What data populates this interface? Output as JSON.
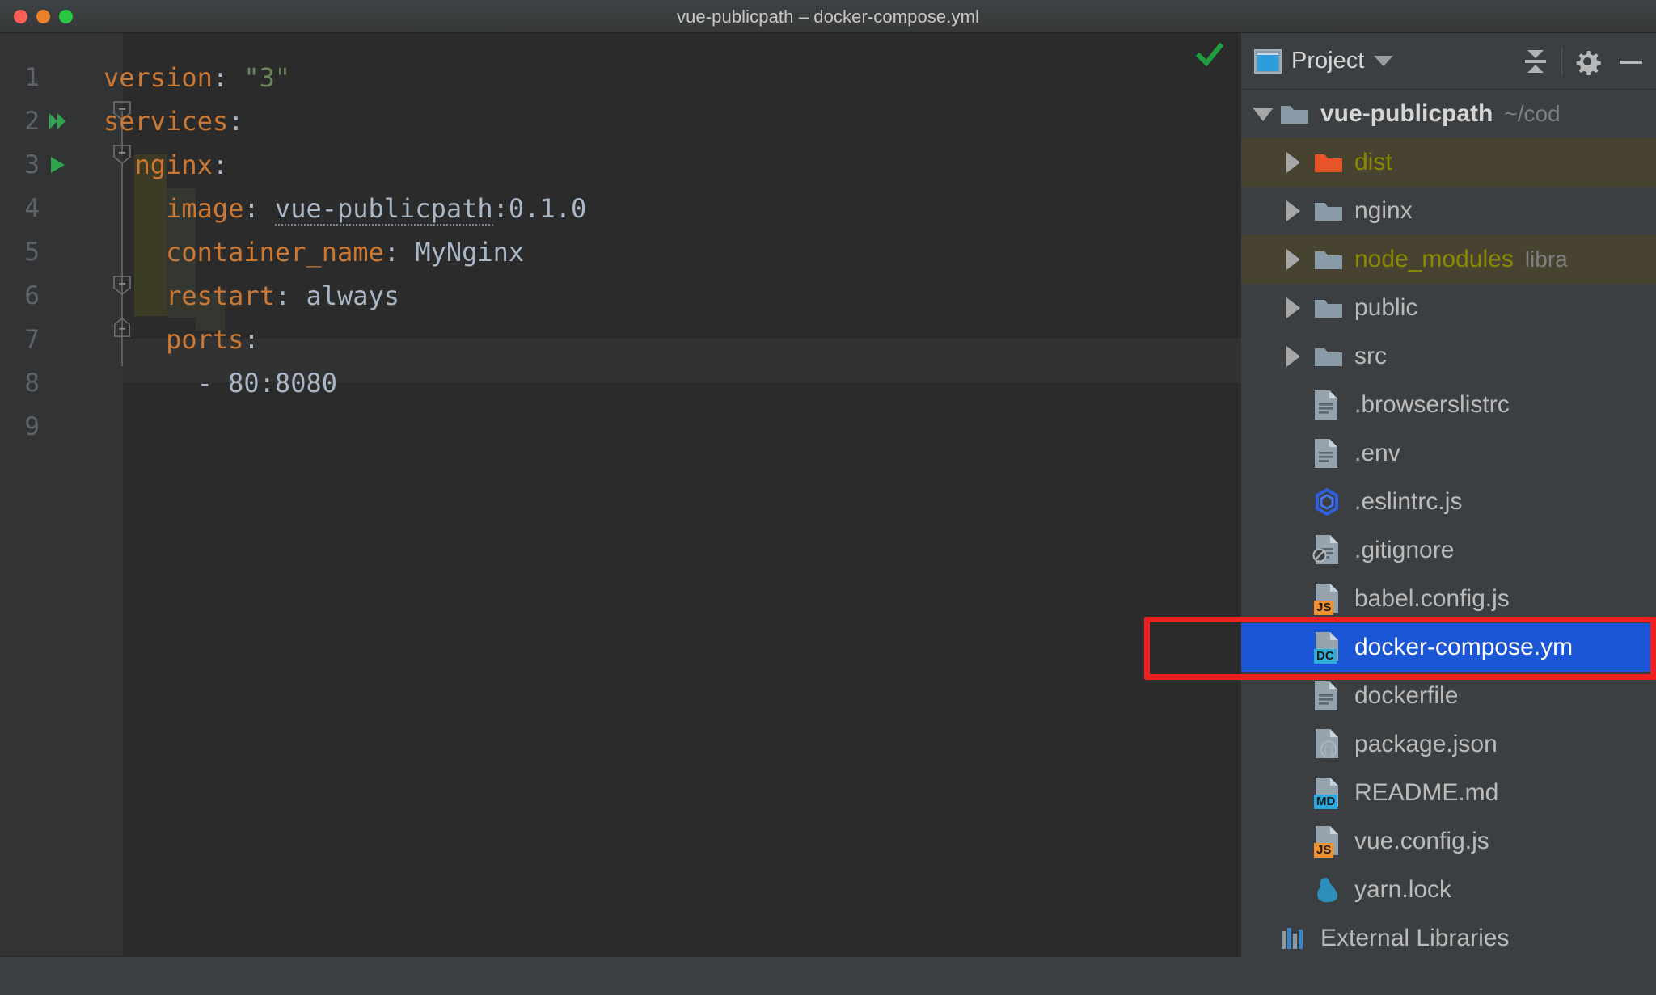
{
  "window": {
    "title": "vue-publicpath – docker-compose.yml",
    "controls": [
      "close",
      "minimize",
      "maximize"
    ]
  },
  "editor": {
    "language": "yaml",
    "inspection_status": "ok",
    "gutter": {
      "run_line_2": "run-all-services",
      "run_line_3": "run-service"
    },
    "lines": [
      {
        "num": "1",
        "tokens": [
          {
            "t": "version",
            "c": "key"
          },
          {
            "t": ":",
            "c": "colon"
          },
          {
            "t": " ",
            "c": "plain"
          },
          {
            "t": "\"3\"",
            "c": "str"
          }
        ]
      },
      {
        "num": "2",
        "tokens": [
          {
            "t": "services",
            "c": "key"
          },
          {
            "t": ":",
            "c": "colon"
          }
        ]
      },
      {
        "num": "3",
        "tokens": [
          {
            "t": "  nginx",
            "c": "key"
          },
          {
            "t": ":",
            "c": "colon"
          }
        ]
      },
      {
        "num": "4",
        "tokens": [
          {
            "t": "    image",
            "c": "key"
          },
          {
            "t": ":",
            "c": "colon"
          },
          {
            "t": " ",
            "c": "plain"
          },
          {
            "t": "vue-publicpath",
            "c": "link"
          },
          {
            "t": ":",
            "c": "colon"
          },
          {
            "t": "0.1.0",
            "c": "num"
          }
        ]
      },
      {
        "num": "5",
        "tokens": [
          {
            "t": "    container_name",
            "c": "key"
          },
          {
            "t": ":",
            "c": "colon"
          },
          {
            "t": " ",
            "c": "plain"
          },
          {
            "t": "MyNginx",
            "c": "val"
          }
        ]
      },
      {
        "num": "6",
        "tokens": [
          {
            "t": "    restart",
            "c": "key"
          },
          {
            "t": ":",
            "c": "colon"
          },
          {
            "t": " ",
            "c": "plain"
          },
          {
            "t": "always",
            "c": "val"
          }
        ]
      },
      {
        "num": "7",
        "tokens": [
          {
            "t": "    ports",
            "c": "key"
          },
          {
            "t": ":",
            "c": "colon"
          }
        ]
      },
      {
        "num": "8",
        "tokens": [
          {
            "t": "      - ",
            "c": "dash"
          },
          {
            "t": "80:8080",
            "c": "num"
          }
        ]
      },
      {
        "num": "9",
        "tokens": []
      }
    ],
    "raw_text": "version: \"3\"\nservices:\n  nginx:\n    image: vue-publicpath:0.1.0\n    container_name: MyNginx\n    restart: always\n    ports:\n      - 80:8080\n"
  },
  "panel": {
    "title": "Project",
    "icons": {
      "project": "project-icon",
      "dropdown": "chevron-down-icon",
      "collapse_all": "collapse-all-icon",
      "settings": "gear-icon",
      "hide": "minimize-icon"
    },
    "tree": [
      {
        "label": "vue-publicpath",
        "suffix": "~/cod",
        "kind": "folder",
        "icon": "folder-gray",
        "depth": 0,
        "expanded": true,
        "arrow": "down",
        "style": "bold",
        "highlight": "none"
      },
      {
        "label": "dist",
        "suffix": "",
        "kind": "folder",
        "icon": "folder-orange",
        "depth": 1,
        "expanded": false,
        "arrow": "right",
        "style": "olive",
        "highlight": "olive"
      },
      {
        "label": "nginx",
        "suffix": "",
        "kind": "folder",
        "icon": "folder-gray",
        "depth": 1,
        "expanded": false,
        "arrow": "right",
        "style": "normal",
        "highlight": "none"
      },
      {
        "label": "node_modules",
        "suffix": "libra",
        "kind": "folder",
        "icon": "folder-gray",
        "depth": 1,
        "expanded": false,
        "arrow": "right",
        "style": "olive",
        "highlight": "olive"
      },
      {
        "label": "public",
        "suffix": "",
        "kind": "folder",
        "icon": "folder-gray",
        "depth": 1,
        "expanded": false,
        "arrow": "right",
        "style": "normal",
        "highlight": "none"
      },
      {
        "label": "src",
        "suffix": "",
        "kind": "folder",
        "icon": "folder-gray",
        "depth": 1,
        "expanded": false,
        "arrow": "right",
        "style": "normal",
        "highlight": "none"
      },
      {
        "label": ".browserslistrc",
        "suffix": "",
        "kind": "file",
        "icon": "file-text",
        "depth": 1,
        "arrow": "none",
        "style": "normal",
        "highlight": "none"
      },
      {
        "label": ".env",
        "suffix": "",
        "kind": "file",
        "icon": "file-text",
        "depth": 1,
        "arrow": "none",
        "style": "normal",
        "highlight": "none"
      },
      {
        "label": ".eslintrc.js",
        "suffix": "",
        "kind": "file",
        "icon": "file-eslint",
        "depth": 1,
        "arrow": "none",
        "style": "normal",
        "highlight": "none"
      },
      {
        "label": ".gitignore",
        "suffix": "",
        "kind": "file",
        "icon": "file-gitignore",
        "depth": 1,
        "arrow": "none",
        "style": "normal",
        "highlight": "none"
      },
      {
        "label": "babel.config.js",
        "suffix": "",
        "kind": "file",
        "icon": "file-js",
        "depth": 1,
        "arrow": "none",
        "style": "normal",
        "highlight": "none"
      },
      {
        "label": "docker-compose.ym",
        "suffix": "",
        "kind": "file",
        "icon": "file-dockercompose",
        "depth": 1,
        "arrow": "none",
        "style": "white",
        "highlight": "selected"
      },
      {
        "label": "dockerfile",
        "suffix": "",
        "kind": "file",
        "icon": "file-text",
        "depth": 1,
        "arrow": "none",
        "style": "normal",
        "highlight": "none"
      },
      {
        "label": "package.json",
        "suffix": "",
        "kind": "file",
        "icon": "file-json",
        "depth": 1,
        "arrow": "none",
        "style": "normal",
        "highlight": "none"
      },
      {
        "label": "README.md",
        "suffix": "",
        "kind": "file",
        "icon": "file-md",
        "depth": 1,
        "arrow": "none",
        "style": "normal",
        "highlight": "none"
      },
      {
        "label": "vue.config.js",
        "suffix": "",
        "kind": "file",
        "icon": "file-js",
        "depth": 1,
        "arrow": "none",
        "style": "normal",
        "highlight": "none"
      },
      {
        "label": "yarn.lock",
        "suffix": "",
        "kind": "file",
        "icon": "file-yarn",
        "depth": 1,
        "arrow": "none",
        "style": "normal",
        "highlight": "none"
      },
      {
        "label": "External Libraries",
        "suffix": "",
        "kind": "node",
        "icon": "libraries",
        "depth": 0,
        "arrow": "none",
        "style": "normal",
        "highlight": "none"
      }
    ]
  },
  "annotation": {
    "type": "red-rectangle",
    "target": "docker-compose.ym"
  },
  "colors": {
    "editor_bg": "#2b2b2b",
    "gutter_bg": "#313335",
    "panel_bg": "#3c3f41",
    "selection_blue": "#1a56d6",
    "key_orange": "#cc7832",
    "value_blue": "#a9b7c6",
    "string_green": "#6a8759",
    "olive_highlight": "#474330",
    "annotation_red": "#f02020",
    "run_green": "#2ea44f"
  }
}
